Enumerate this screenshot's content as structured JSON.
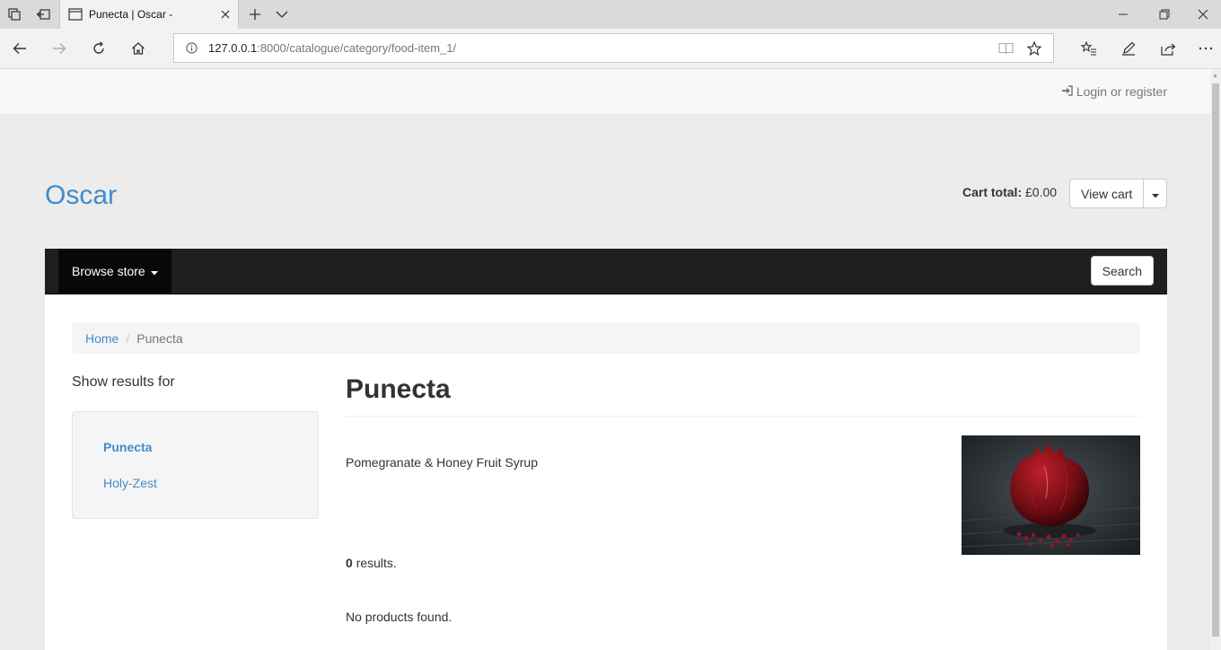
{
  "browser": {
    "tab_title": "Punecta | Oscar -",
    "url_host": "127.0.0.1",
    "url_rest": ":8000/catalogue/category/food-item_1/"
  },
  "site": {
    "login_label": "Login or register",
    "brand": "Oscar",
    "cart_total_label": "Cart total:",
    "cart_total_value": "£0.00",
    "view_cart_label": "View cart",
    "browse_store_label": "Browse store",
    "search_label": "Search"
  },
  "breadcrumb": {
    "home": "Home",
    "separator": "/",
    "current": "Punecta"
  },
  "sidebar": {
    "title": "Show results for",
    "items": [
      {
        "label": "Punecta",
        "active": true
      },
      {
        "label": "Holy-Zest",
        "active": false
      }
    ]
  },
  "main": {
    "title": "Punecta",
    "description": "Pomegranate & Honey Fruit Syrup",
    "results_count": "0",
    "results_suffix": "results.",
    "empty_message": "No products found."
  },
  "colors": {
    "link": "#428bca",
    "navbar": "#1f1f1f"
  }
}
